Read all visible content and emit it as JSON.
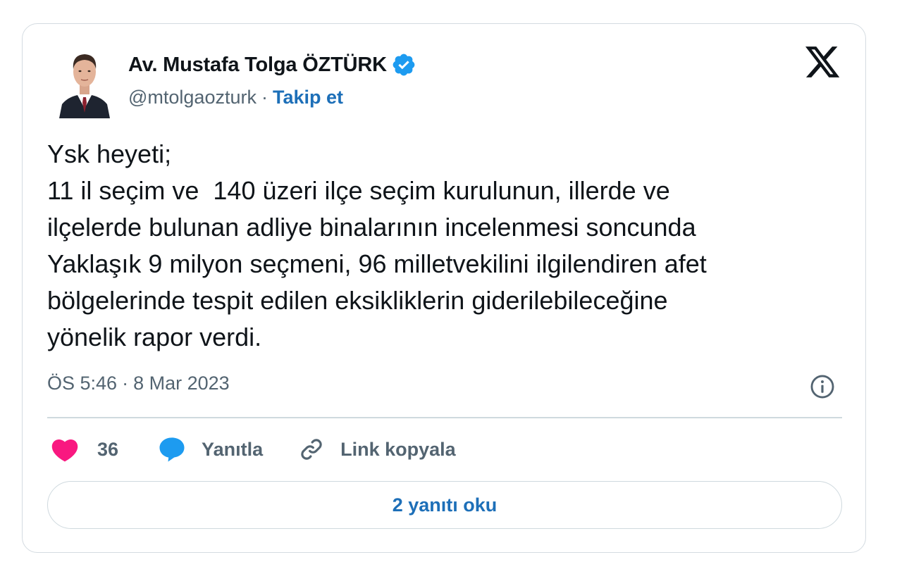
{
  "author": {
    "display_name": "Av. Mustafa Tolga ÖZTÜRK",
    "handle": "@mtolgaozturk",
    "separator": "·",
    "follow_label": "Takip et",
    "verified": true
  },
  "tweet": {
    "lines": [
      "Ysk heyeti;",
      "11 il seçim ve  140 üzeri ilçe seçim kurulunun, illerde ve",
      "ilçelerde bulunan adliye binalarının incelenmesi soncunda",
      "Yaklaşık 9 milyon seçmeni, 96 milletvekilini ilgilendiren afet",
      "bölgelerinde tespit edilen eksikliklerin giderilebileceğine",
      "yönelik rapor verdi."
    ],
    "time": "ÖS 5:46",
    "date_separator": "·",
    "date": "8 Mar 2023"
  },
  "actions": {
    "like_count": "36",
    "reply_label": "Yanıtla",
    "copy_link_label": "Link kopyala"
  },
  "read_replies_label": "2 yanıtı oku",
  "icons": {
    "platform": "x-logo-icon",
    "verified": "verified-badge-icon",
    "info": "info-icon",
    "like": "heart-icon",
    "reply": "speech-bubble-icon",
    "link": "link-icon"
  },
  "colors": {
    "text": "#0f1419",
    "secondary": "#536471",
    "link_blue": "#1d6fb8",
    "verified_blue": "#1d9bf0",
    "heart": "#f91880",
    "border": "#cfd9de"
  }
}
